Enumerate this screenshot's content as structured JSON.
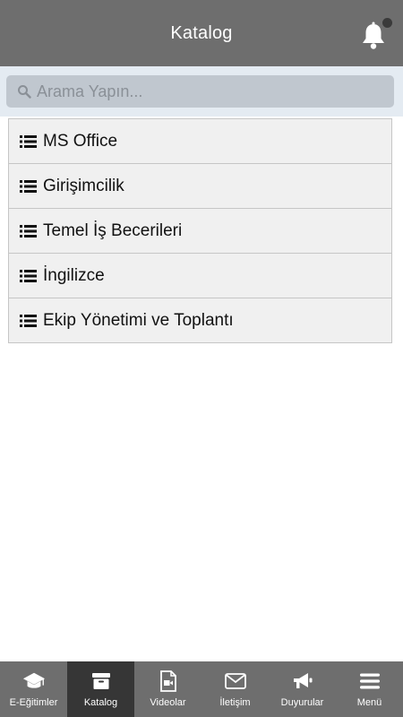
{
  "header": {
    "title": "Katalog",
    "notification_icon": "bell-icon"
  },
  "search": {
    "placeholder": "Arama Yapın...",
    "value": ""
  },
  "catalog": {
    "items": [
      {
        "label": "MS Office",
        "icon": "list-icon"
      },
      {
        "label": "Girişimcilik",
        "icon": "list-icon"
      },
      {
        "label": "Temel İş Becerileri",
        "icon": "list-icon"
      },
      {
        "label": "İngilizce",
        "icon": "list-icon"
      },
      {
        "label": "Ekip Yönetimi ve Toplantı",
        "icon": "list-icon"
      }
    ]
  },
  "tabbar": {
    "active": "Katalog",
    "tabs": [
      {
        "label": "E-Eğitimler",
        "icon": "graduation-cap-icon"
      },
      {
        "label": "Katalog",
        "icon": "archive-box-icon"
      },
      {
        "label": "Videolar",
        "icon": "video-file-icon"
      },
      {
        "label": "İletişim",
        "icon": "envelope-icon"
      },
      {
        "label": "Duyurular",
        "icon": "megaphone-icon"
      },
      {
        "label": "Menü",
        "icon": "hamburger-icon"
      }
    ]
  },
  "colors": {
    "header_bg": "#6e6e6e",
    "search_bar_bg": "#e4ebf2",
    "search_box_bg": "#c0c7cf",
    "list_item_bg": "#f0f0f0",
    "tab_active_bg": "#363636"
  }
}
